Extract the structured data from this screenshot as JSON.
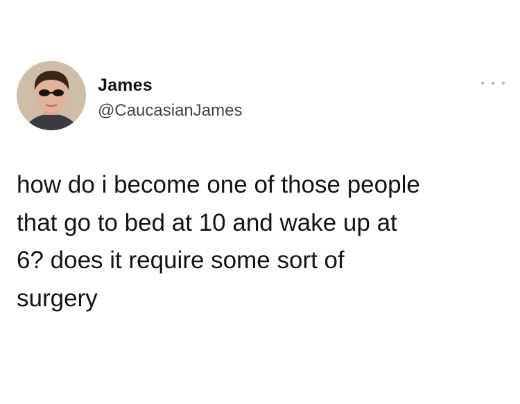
{
  "tweet": {
    "display_name": "James",
    "handle": "@CaucasianJames",
    "avatar_icon": "profile-photo",
    "more_icon": "more-options-icon",
    "text": "how do i become one of those people\nthat go to bed at 10 and wake up at\n6? does it require some sort of\nsurgery"
  }
}
